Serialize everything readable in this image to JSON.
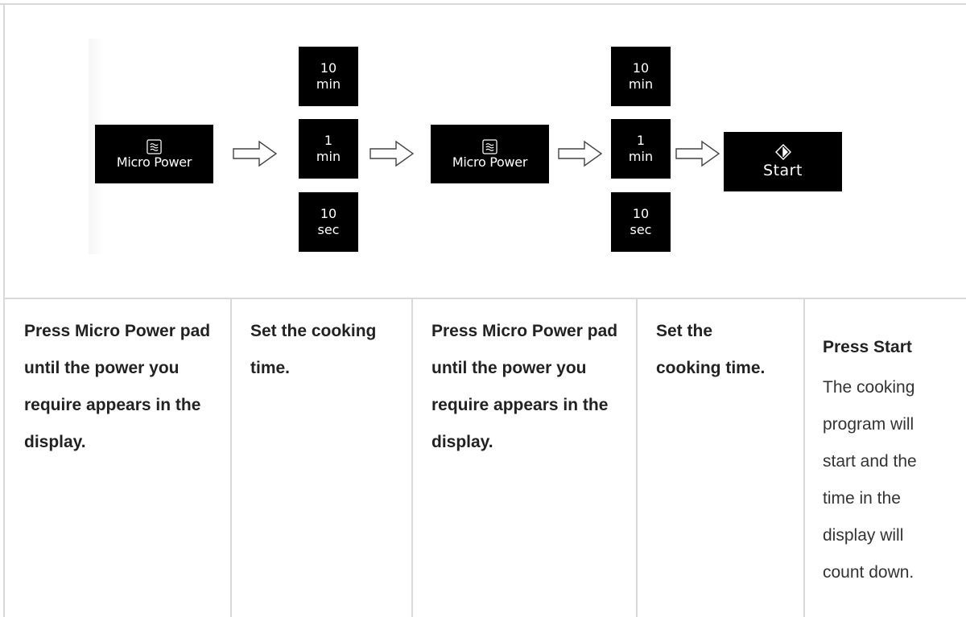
{
  "diagram": {
    "pads": {
      "micro_power_1": "Micro Power",
      "micro_power_2": "Micro Power",
      "time_a": {
        "ten_min": [
          "10",
          "min"
        ],
        "one_min": [
          "1",
          "min"
        ],
        "ten_sec": [
          "10",
          "sec"
        ]
      },
      "time_b": {
        "ten_min": [
          "10",
          "min"
        ],
        "one_min": [
          "1",
          "min"
        ],
        "ten_sec": [
          "10",
          "sec"
        ]
      },
      "start": "Start"
    },
    "icons": {
      "micro_power": "microwave-wave-icon",
      "start": "start-diamond-icon",
      "arrow": "right-outline-arrow-icon"
    }
  },
  "steps": [
    {
      "heading": "Press Micro Power pad until the power you require appears in the display."
    },
    {
      "heading": "Set the cooking time."
    },
    {
      "heading": "Press Micro Power pad until the power you require appears in the display."
    },
    {
      "heading": "Set the cooking time."
    },
    {
      "heading": "Press Start",
      "body": "The cooking program will start and the time in the display will count down."
    }
  ],
  "colors": {
    "pad": "#000000",
    "pad_text": "#ffffff",
    "border": "#d9d9d9",
    "text": "#222222"
  }
}
